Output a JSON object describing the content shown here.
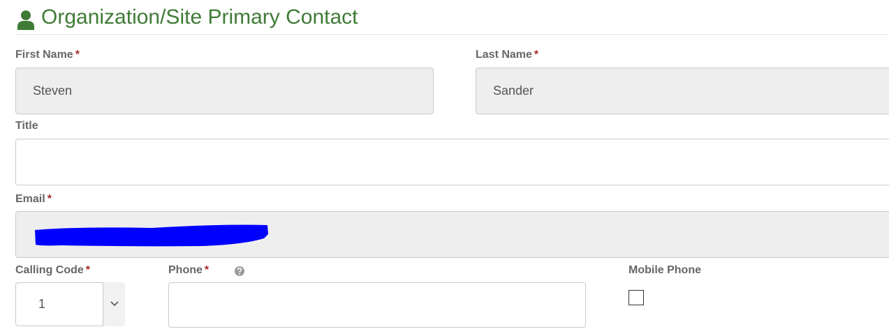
{
  "section": {
    "title": "Organization/Site Primary Contact",
    "icon": "user-icon",
    "accent_color": "#3f7b36"
  },
  "required_marker": "*",
  "required_color": "#a52a2a",
  "fields": {
    "first_name": {
      "label": "First Name",
      "value": "Steven",
      "required": true
    },
    "last_name": {
      "label": "Last Name",
      "value": "Sander",
      "required": true
    },
    "title": {
      "label": "Title",
      "value": ""
    },
    "email": {
      "label": "Email",
      "value": "",
      "required": true,
      "redacted": true,
      "redaction_color": "#0000ff"
    },
    "calling_code": {
      "label": "Calling Code",
      "value": "1",
      "required": true,
      "icon": "chevron-down-icon"
    },
    "phone": {
      "label": "Phone",
      "value": "",
      "required": true,
      "help_icon": "help-icon"
    },
    "mobile_phone": {
      "label": "Mobile Phone",
      "checked": false
    }
  }
}
